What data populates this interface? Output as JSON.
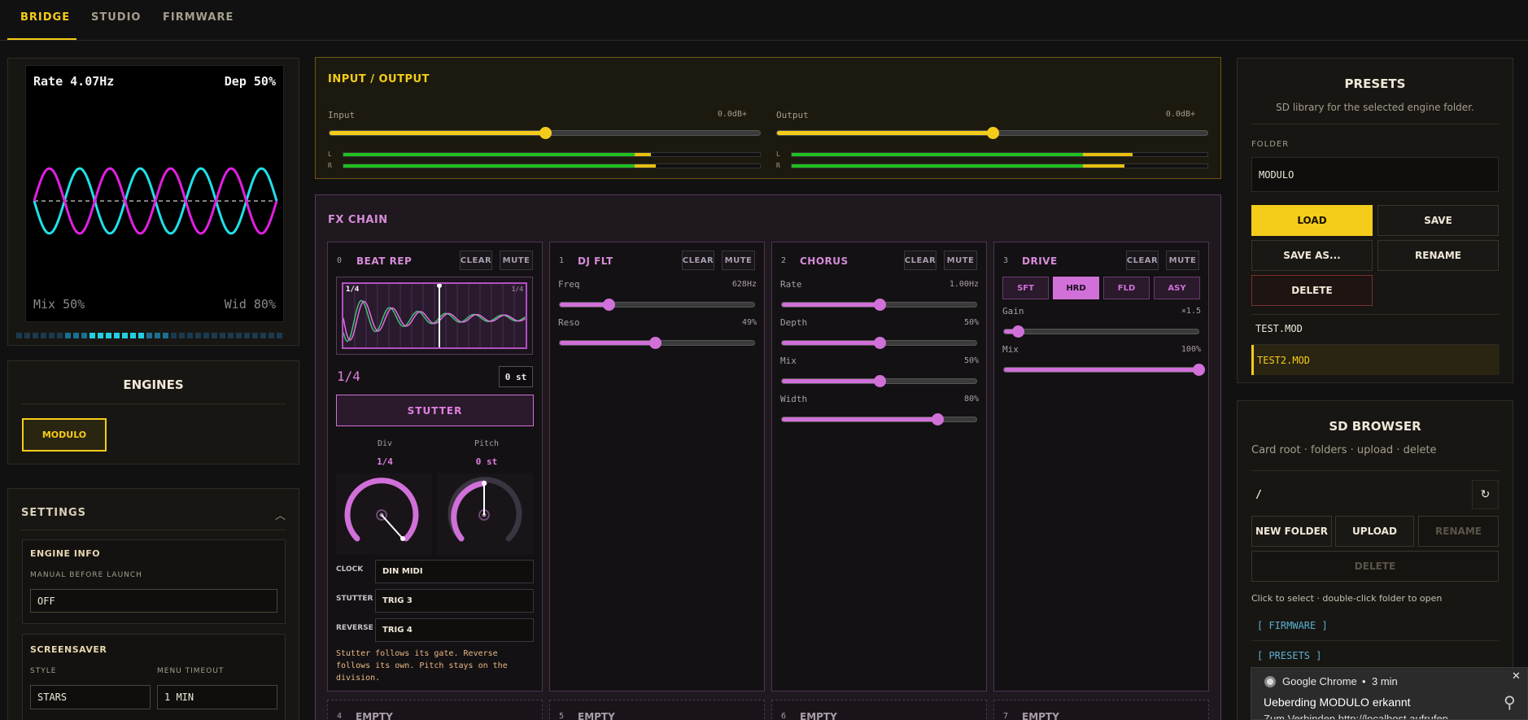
{
  "nav": {
    "tabs": [
      "BRIDGE",
      "STUDIO",
      "FIRMWARE"
    ]
  },
  "lfo": {
    "rate": "Rate 4.07Hz",
    "depth": "Dep 50%",
    "mix": "Mix 50%",
    "width": "Wid 80%"
  },
  "engines": {
    "title": "ENGINES",
    "active": "MODULO"
  },
  "settings": {
    "title": "SETTINGS",
    "engine_info": "ENGINE INFO",
    "manual_label": "MANUAL BEFORE LAUNCH",
    "manual_value": "OFF",
    "screensaver": "SCREENSAVER",
    "style_label": "STYLE",
    "style_value": "STARS",
    "timeout_label": "MENU TIMEOUT",
    "timeout_value": "1 MIN"
  },
  "io": {
    "title": "INPUT / OUTPUT",
    "input_label": "Input",
    "input_value": "+0.0dB",
    "output_label": "Output",
    "output_value": "+0.0dB",
    "l": "L",
    "r": "R",
    "input_level": 0.5,
    "output_level": 0.5
  },
  "fx": {
    "title": "FX CHAIN",
    "clear": "CLEAR",
    "mute": "MUTE",
    "slot0": {
      "num": "0",
      "name": "BEAT REP",
      "div": "1/4",
      "semitones": "0 st",
      "stutter": "STUTTER",
      "div_label": "Div",
      "div_value": "1/4",
      "pitch_label": "Pitch",
      "pitch_value": "0 st",
      "wave_left": "1/4",
      "wave_right": "1/4",
      "clock_label": "CLOCK",
      "clock_value": "DIN MIDI",
      "stutter_label": "STUTTER",
      "stutter_value": "TRIG 3",
      "reverse_label": "REVERSE",
      "reverse_value": "TRIG 4",
      "note": "Stutter follows its gate. Reverse follows its own. Pitch stays on the division."
    },
    "slot1": {
      "num": "1",
      "name": "DJ FLT",
      "freq_label": "Freq",
      "freq_value": "628Hz",
      "reso_label": "Reso",
      "reso_value": "49%",
      "freq": 0.25,
      "reso": 0.49
    },
    "slot2": {
      "num": "2",
      "name": "CHORUS",
      "rate_label": "Rate",
      "rate_value": "1.00Hz",
      "depth_label": "Depth",
      "depth_value": "50%",
      "mix_label": "Mix",
      "mix_value": "50%",
      "width_label": "Width",
      "width_value": "80%",
      "rate": 0.5,
      "depth": 0.5,
      "mix": 0.5,
      "width": 0.8
    },
    "slot3": {
      "num": "3",
      "name": "DRIVE",
      "modes": [
        "SFT",
        "HRD",
        "FLD",
        "ASY"
      ],
      "active_mode": "HRD",
      "gain_label": "Gain",
      "gain_value": "×1.5",
      "mix_label": "Mix",
      "mix_value": "100%",
      "gain": 0.07,
      "mix": 1.0
    },
    "empty": [
      {
        "num": "4",
        "name": "EMPTY"
      },
      {
        "num": "5",
        "name": "EMPTY"
      },
      {
        "num": "6",
        "name": "EMPTY"
      },
      {
        "num": "7",
        "name": "EMPTY"
      }
    ]
  },
  "presets": {
    "title": "PRESETS",
    "subtitle": "SD library for the selected engine folder.",
    "folder_label": "FOLDER",
    "folder_value": "MODULO",
    "load": "LOAD",
    "save": "SAVE",
    "save_as": "SAVE AS...",
    "rename": "RENAME",
    "delete": "DELETE",
    "files": [
      "TEST.MOD",
      "TEST2.MOD"
    ]
  },
  "sd": {
    "title": "SD BROWSER",
    "subtitle": "Card root · folders · upload · delete",
    "path": "/",
    "refresh": "↻",
    "new_folder": "NEW FOLDER",
    "upload": "UPLOAD",
    "rename": "RENAME",
    "delete": "DELETE",
    "hint": "Click to select · double-click folder to open",
    "entries": [
      "[ FIRMWARE ]",
      "[ PRESETS ]"
    ]
  },
  "toast": {
    "app": "Google Chrome",
    "time": "3 min",
    "title": "Ueberding MODULO erkannt",
    "body": "Zum Verbinden http://localhost aufrufen",
    "close": "✕"
  },
  "colors": {
    "accent": "#f5cc1a",
    "fx": "#d070d8",
    "cyan": "#20e0e8",
    "magenta": "#e020e0"
  }
}
